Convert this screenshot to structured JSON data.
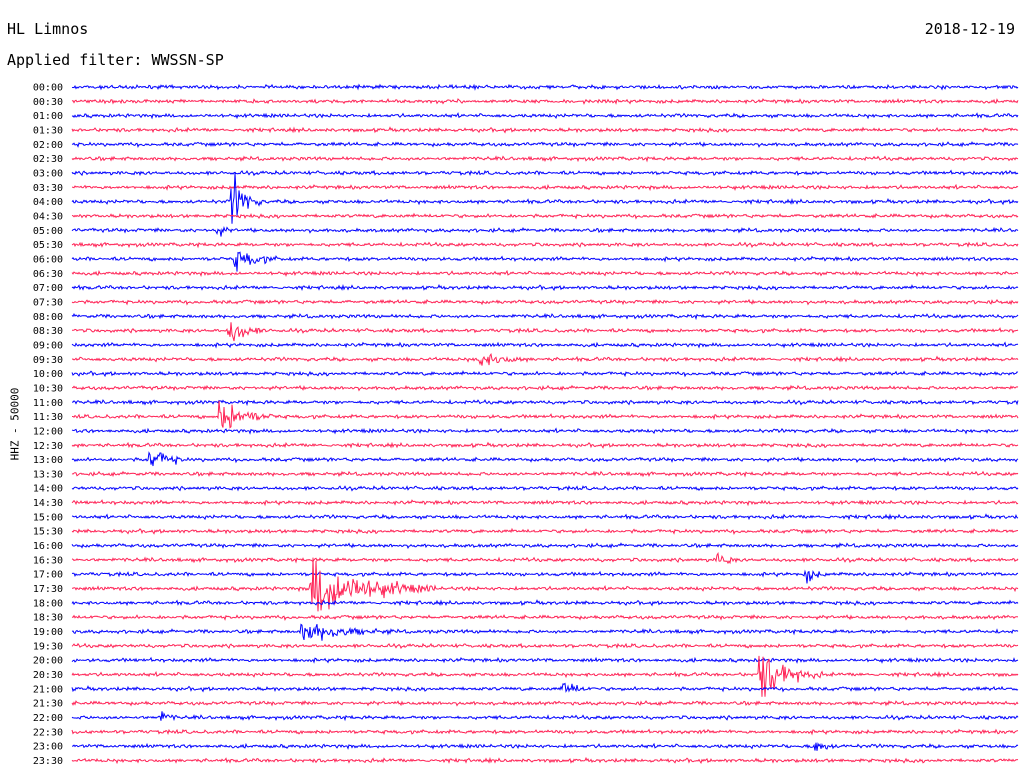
{
  "header": {
    "station": "HL Limnos",
    "date": "2018-12-19",
    "filter": "Applied filter: WWSSN-SP"
  },
  "chart_data": {
    "type": "line",
    "title": "HL Limnos",
    "ylabel": "HHZ - 50000",
    "row_labels": [
      "00:00",
      "00:30",
      "01:00",
      "01:30",
      "02:00",
      "02:30",
      "03:00",
      "03:30",
      "04:00",
      "04:30",
      "05:00",
      "05:30",
      "06:00",
      "06:30",
      "07:00",
      "07:30",
      "08:00",
      "08:30",
      "09:00",
      "09:30",
      "10:00",
      "10:30",
      "11:00",
      "11:30",
      "12:00",
      "12:30",
      "13:00",
      "13:30",
      "14:00",
      "14:30",
      "15:00",
      "15:30",
      "16:00",
      "16:30",
      "17:00",
      "17:30",
      "18:00",
      "18:30",
      "19:00",
      "19:30",
      "20:00",
      "20:30",
      "21:00",
      "21:30",
      "22:00",
      "22:30",
      "23:00",
      "23:30"
    ],
    "trace_colors": [
      "#0000ff",
      "#ff2255"
    ],
    "noise_level": 0.25,
    "events": [
      {
        "row": 8,
        "minute": 5.1,
        "amp": 5,
        "duration_min": 1,
        "color": "#0000ff"
      },
      {
        "row": 10,
        "minute": 4.6,
        "amp": 1.4,
        "duration_min": 0.8,
        "color": "#0000ff"
      },
      {
        "row": 12,
        "minute": 5.2,
        "amp": 2,
        "duration_min": 2,
        "color": "#ff2255"
      },
      {
        "row": 17,
        "minute": 5.0,
        "amp": 2.5,
        "duration_min": 1.5,
        "color": "#ff2255"
      },
      {
        "row": 19,
        "minute": 12.9,
        "amp": 1.6,
        "duration_min": 2.5,
        "color": "#0000ff"
      },
      {
        "row": 23,
        "minute": 4.7,
        "amp": 3.5,
        "duration_min": 2,
        "color": "#0000ff"
      },
      {
        "row": 26,
        "minute": 2.5,
        "amp": 2.3,
        "duration_min": 1.5,
        "color": "#0000ff"
      },
      {
        "row": 33,
        "minute": 20.5,
        "amp": 1.4,
        "duration_min": 1,
        "color": "#0000ff"
      },
      {
        "row": 34,
        "minute": 23.3,
        "amp": 1.5,
        "duration_min": 1,
        "color": "#ff2255"
      },
      {
        "row": 35,
        "minute": 7.6,
        "amp": 6,
        "duration_min": 4,
        "color": "#ff2255"
      },
      {
        "row": 38,
        "minute": 7.3,
        "amp": 2,
        "duration_min": 4,
        "color": "#ff2255"
      },
      {
        "row": 41,
        "minute": 21.8,
        "amp": 5,
        "duration_min": 2,
        "color": "#0000ff"
      },
      {
        "row": 42,
        "minute": 15.6,
        "amp": 1.8,
        "duration_min": 1.2,
        "color": "#0000ff"
      },
      {
        "row": 44,
        "minute": 2.8,
        "amp": 1.3,
        "duration_min": 1,
        "color": "#0000ff"
      },
      {
        "row": 46,
        "minute": 23.6,
        "amp": 1.6,
        "duration_min": 1,
        "color": "#0000ff"
      }
    ]
  }
}
